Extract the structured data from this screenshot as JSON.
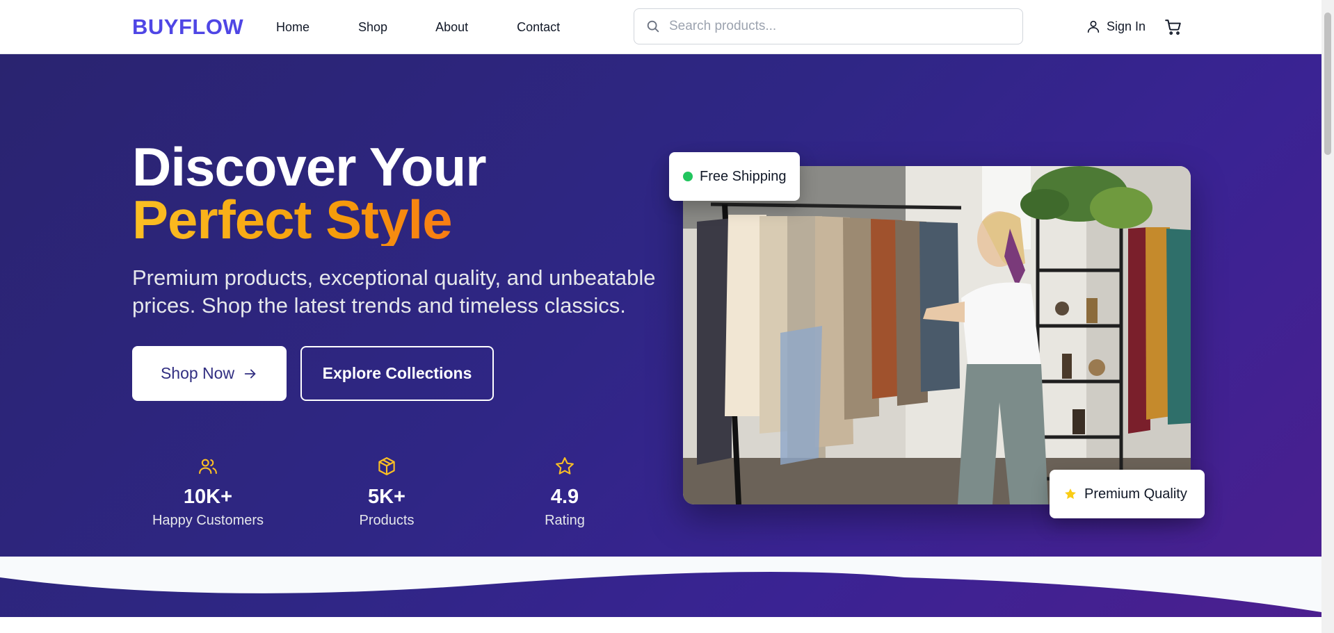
{
  "header": {
    "logo": "BUYFLOW",
    "nav": [
      "Home",
      "Shop",
      "About",
      "Contact"
    ],
    "search_placeholder": "Search products...",
    "sign_in": "Sign In",
    "icons": {
      "search": "search-icon",
      "user": "user-icon",
      "cart": "cart-icon"
    }
  },
  "hero": {
    "title_line1": "Discover Your",
    "title_line2": "Perfect Style",
    "subtitle": "Premium products, exceptional quality, and unbeatable prices. Shop the latest trends and timeless classics.",
    "primary_button": "Shop Now",
    "secondary_button": "Explore Collections",
    "stats": [
      {
        "icon": "users-icon",
        "value": "10K+",
        "label": "Happy Customers"
      },
      {
        "icon": "box-icon",
        "value": "5K+",
        "label": "Products"
      },
      {
        "icon": "star-icon",
        "value": "4.9",
        "label": "Rating"
      }
    ],
    "badges": {
      "shipping": "Free Shipping",
      "quality": "Premium Quality"
    }
  },
  "colors": {
    "brand": "#4f46e5",
    "hero_bg_start": "#2a2470",
    "hero_bg_end": "#4c1f8f",
    "accent_gold": "#fbbf24",
    "accent_orange": "#f97316",
    "stat_icon": "#fbbf24",
    "shipping_dot": "#22c55e"
  }
}
